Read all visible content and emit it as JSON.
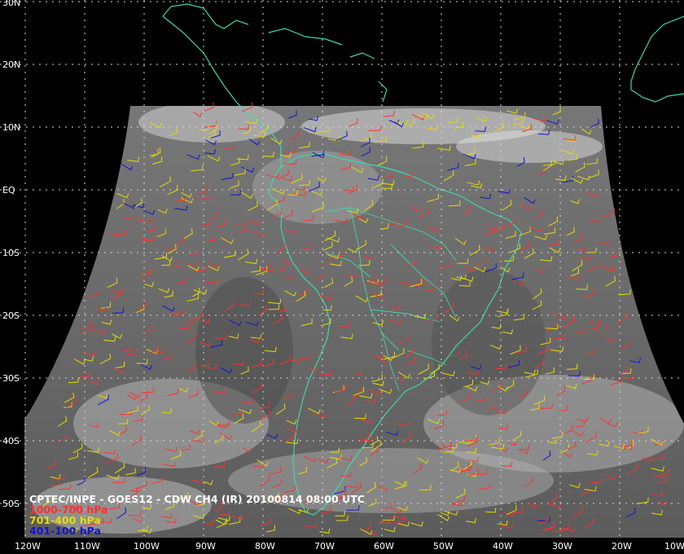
{
  "caption": {
    "title": "CPTEC/INPE - GOES12 - CDW CH4 (IR) 20100814 08:00 UTC"
  },
  "legend": [
    {
      "label": "1000-700 hPa",
      "color": "#ff3030"
    },
    {
      "label": "701-400 hPa",
      "color": "#e6dc00"
    },
    {
      "label": "401-100 hPa",
      "color": "#1414d0"
    }
  ],
  "lat_labels": [
    "30N",
    "20N",
    "10N",
    "EQ",
    "10S",
    "20S",
    "30S",
    "40S",
    "50S"
  ],
  "lon_labels": [
    "120W",
    "110W",
    "100W",
    "90W",
    "80W",
    "70W",
    "60W",
    "50W",
    "40W",
    "30W",
    "20W",
    "10W"
  ],
  "colors": {
    "background": "#000000",
    "coastline": "#3fd7a8",
    "grid": "#d8d8d8",
    "image_disk": "#6a6a6a"
  }
}
